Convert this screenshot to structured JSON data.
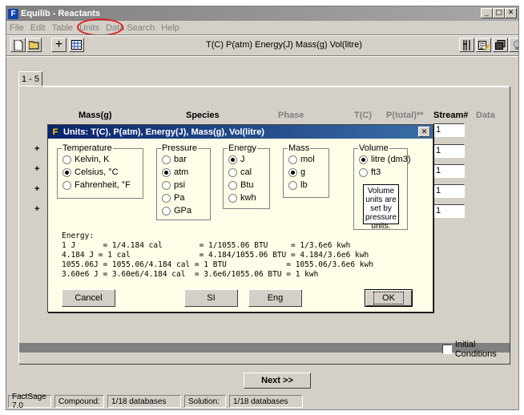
{
  "window": {
    "title": "Equilib - Reactants",
    "app_icon": "F"
  },
  "menu": [
    "File",
    "Edit",
    "Table",
    "Units",
    "Data Search",
    "Help"
  ],
  "toolbar": {
    "caption": "T(C) P(atm) Energy(J) Mass(g) Vol(litre)"
  },
  "tab": {
    "label": "1 - 5"
  },
  "columns": {
    "mass": "Mass(g)",
    "species": "Species",
    "phase": "Phase",
    "tc": "T(C)",
    "ptotal": "P(total)**",
    "stream": "Stream#",
    "data": "Data"
  },
  "rows": [
    {
      "plus": "+",
      "stream": "1"
    },
    {
      "plus": "+",
      "stream": "1"
    },
    {
      "plus": "+",
      "stream": "1"
    },
    {
      "plus": "+",
      "stream": "1"
    },
    {
      "plus": "",
      "stream": "1"
    }
  ],
  "initial_conditions": "Initial Conditions",
  "next_button": "Next >>",
  "status": {
    "version": "FactSage 7.0",
    "compound_label": "Compound:",
    "compound_db": "1/18 databases",
    "solution_label": "Solution:",
    "solution_db": "1/18 databases"
  },
  "dialog": {
    "title": "Units: T(C), P(atm), Energy(J), Mass(g), Vol(litre)",
    "icon": "F",
    "temperature": {
      "label": "Temperature",
      "options": [
        "Kelvin, K",
        "Celsius, °C",
        "Fahrenheit, °F"
      ],
      "selected": 1
    },
    "pressure": {
      "label": "Pressure",
      "options": [
        "bar",
        "atm",
        "psi",
        "Pa",
        "GPa"
      ],
      "selected": 1
    },
    "energy": {
      "label": "Energy",
      "options": [
        "J",
        "cal",
        "Btu",
        "kwh"
      ],
      "selected": 0
    },
    "mass": {
      "label": "Mass",
      "options": [
        "mol",
        "g",
        "lb"
      ],
      "selected": 1
    },
    "volume": {
      "label": "Volume",
      "options": [
        "litre (dm3)",
        "ft3"
      ],
      "selected": 0,
      "note": "Volume units are set by pressure units."
    },
    "energy_table": [
      "Energy:",
      "1 J      = 1/4.184 cal        = 1/1055.06 BTU     = 1/3.6e6 kwh",
      "4.184 J = 1 cal               = 4.184/1055.06 BTU = 4.184/3.6e6 kwh",
      "1055.06J = 1055.06/4.184 cal = 1 BTU             = 1055.06/3.6e6 kwh",
      "3.60e6 J = 3.60e6/4.184 cal  = 3.6e6/1055.06 BTU = 1 kwh"
    ],
    "buttons": {
      "cancel": "Cancel",
      "si": "SI",
      "eng": "Eng",
      "ok": "OK"
    }
  },
  "colors": {
    "annotation_circle": "#e02020",
    "dialog_bg": "#fffde7"
  }
}
